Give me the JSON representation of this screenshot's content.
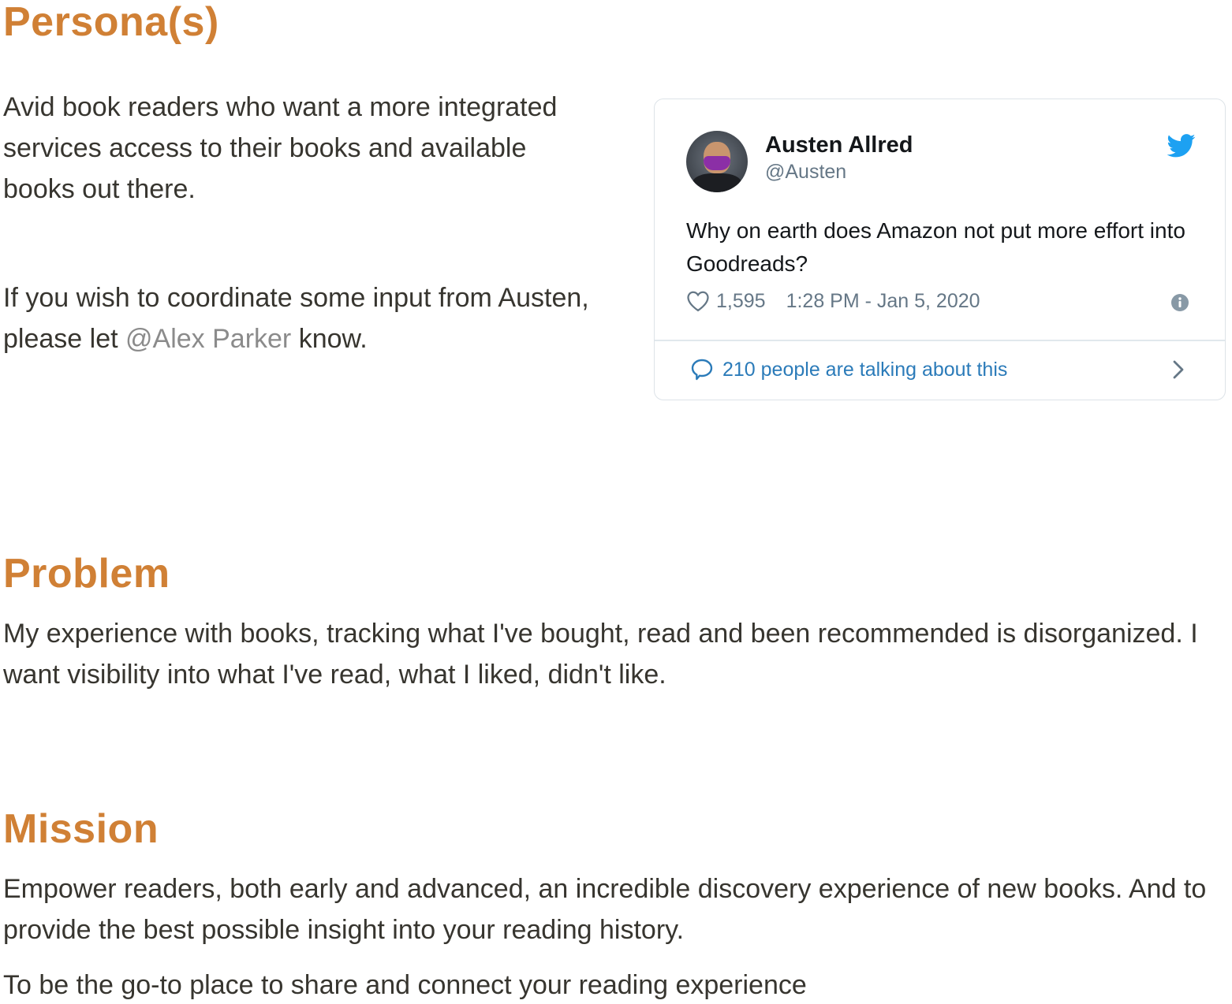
{
  "sections": {
    "persona": {
      "title": "Persona(s)",
      "para1": "Avid book readers who want a more integrated services access to their books and available books out there.",
      "para2_before": "If you wish to coordinate some input from Austen, please let ",
      "para2_mention": "@Alex Parker",
      "para2_after": " know."
    },
    "problem": {
      "title": "Problem",
      "text": "My experience with books, tracking what I've bought, read and been recommended is disorganized. I want visibility into what I've read, what I liked, didn't like."
    },
    "mission": {
      "title": "Mission",
      "text1": "Empower readers, both early and advanced, an incredible discovery experience of new books. And to provide the best possible insight into your reading history.",
      "text2": "To be the go-to place to share and connect your reading experience"
    }
  },
  "tweet": {
    "author_name": "Austen Allred",
    "author_handle": "@Austen",
    "text": "Why on earth does Amazon not put more effort into Goodreads?",
    "likes": "1,595",
    "timestamp": "1:28 PM - Jan 5, 2020",
    "conversation": "210 people are talking about this",
    "icons": {
      "brand": "twitter-bird-icon",
      "like": "heart-icon",
      "info": "info-icon",
      "reply": "speech-bubble-icon",
      "more": "chevron-right-icon"
    }
  },
  "colors": {
    "heading": "#d08035",
    "body_text": "#37352f",
    "mention": "#8b8b8b",
    "twitter_blue": "#1da1f2",
    "link_blue": "#2b7bb9",
    "muted": "#657786"
  }
}
